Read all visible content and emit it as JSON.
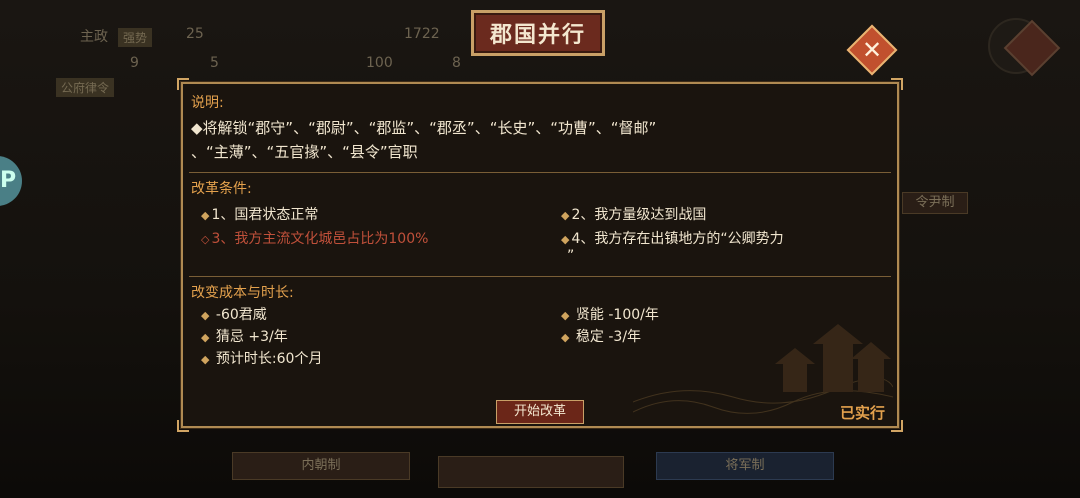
{
  "background": {
    "stats_top": [
      {
        "label": "主政",
        "tag": "强势",
        "value": "25"
      },
      {
        "label": "",
        "tag": "",
        "value": "1722"
      },
      {
        "label": "",
        "tag": "",
        "value": "9"
      },
      {
        "label": "",
        "tag": "",
        "value": "5"
      },
      {
        "label": "",
        "tag": "",
        "value": "100"
      },
      {
        "label": "",
        "tag": "",
        "value": "8"
      }
    ],
    "button_left": "公府律令",
    "cards": [
      "内朝制",
      "将军制",
      "令尹制"
    ]
  },
  "dialog": {
    "title": "郡国并行",
    "close_icon": "close-icon",
    "description": {
      "heading": "说明:",
      "lines": [
        "◆将解锁“郡守”、“郡尉”、“郡监”、“郡丞”、“长史”、“功曹”、“督邮”",
        "、“主薄”、“五官掾”、“县令”官职"
      ]
    },
    "conditions": {
      "heading": "改革条件:",
      "items": [
        {
          "marker": "◆",
          "text": "1、国君状态正常",
          "met": true
        },
        {
          "marker": "◆",
          "text": "2、我方量级达到战国",
          "met": true
        },
        {
          "marker": "◇",
          "text": "3、我方主流文化城邑占比为100%",
          "met": false
        },
        {
          "marker": "◆",
          "text": "4、我方存在出镇地方的“公卿势力",
          "met": true
        }
      ],
      "item4_wrap": "”"
    },
    "costs": {
      "heading": "改变成本与时长:",
      "items": [
        {
          "marker": "◆",
          "text": "-60君威"
        },
        {
          "marker": "◆",
          "text": "贤能 -100/年"
        },
        {
          "marker": "◆",
          "text": "猜忌 +3/年"
        },
        {
          "marker": "◆",
          "text": "稳定 -3/年"
        },
        {
          "marker": "◆",
          "text": "预计时长:60个月"
        }
      ]
    },
    "start_button": "开始改革",
    "status_label": "已实行"
  },
  "colors": {
    "accent_orange": "#e3a14d",
    "fail_red": "#c0503a",
    "panel_border": "#b08a52",
    "title_bg": "#6b2a1e"
  }
}
